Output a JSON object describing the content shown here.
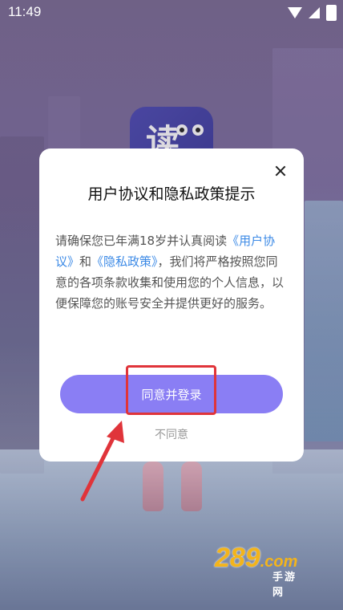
{
  "status_bar": {
    "time": "11:49"
  },
  "dialog": {
    "title": "用户协议和隐私政策提示",
    "body_prefix": "请确保您已年满18岁并认真阅读",
    "link_user_agreement": "《用户协议》",
    "body_and": "和",
    "link_privacy_policy": "《隐私政策》",
    "body_suffix": "，我们将严格按照您同意的各项条款收集和使用您的个人信息，以便保障您的账号安全并提供更好的服务。",
    "agree_button": "同意并登录",
    "disagree_link": "不同意"
  },
  "app_icon": {
    "glyph": "读"
  },
  "watermark": {
    "number": "289",
    "domain": ".com",
    "subtitle": "手游网"
  },
  "colors": {
    "accent": "#8a7ef4",
    "link": "#3c8ae6",
    "annotation": "#e0343a",
    "watermark": "#f3b41b"
  }
}
